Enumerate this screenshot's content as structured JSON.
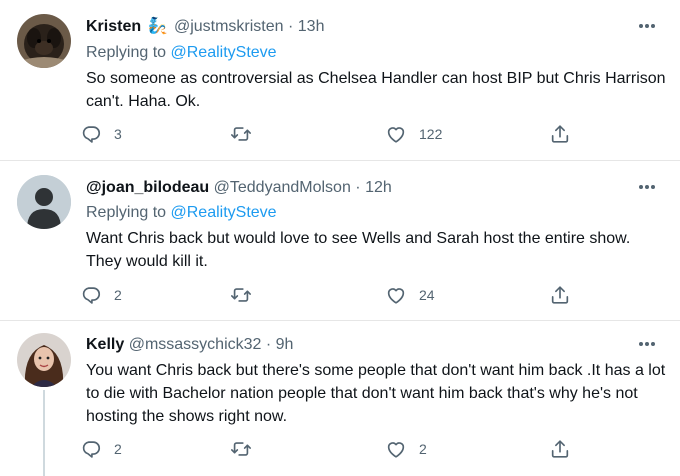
{
  "tweets": [
    {
      "name": "Kristen",
      "emoji": "🧞",
      "handle": "@justmskristen",
      "time": "· 13h",
      "replying_prefix": "Replying to ",
      "replying_to": "@RealitySteve",
      "text": "So someone as controversial as Chelsea Handler can host BIP but Chris Harrison can't. Haha. Ok.",
      "reply_count": "3",
      "retweet_count": "",
      "like_count": "122"
    },
    {
      "name": "@joan_bilodeau",
      "handle": "@TeddyandMolson",
      "time": "· 12h",
      "replying_prefix": "Replying to ",
      "replying_to": "@RealitySteve",
      "text": "Want Chris back but would love to see Wells and Sarah host the entire show. They would kill it.",
      "reply_count": "2",
      "retweet_count": "",
      "like_count": "24"
    },
    {
      "name": "Kelly",
      "handle": "@mssassychick32",
      "time": "· 9h",
      "text": "You want Chris back but  there's some people that don't want him back .It has a lot to die with Bachelor nation people that don't want him back that's why he's not hosting the shows right now.",
      "reply_count": "2",
      "retweet_count": "",
      "like_count": "2"
    }
  ],
  "icons": {
    "reply": "reply-icon",
    "retweet": "retweet-icon",
    "like": "heart-icon",
    "share": "share-icon",
    "more": "more-icon"
  },
  "colors": {
    "link": "#1d9bf0",
    "secondary_text": "#536471",
    "divider": "#e6e6e6"
  }
}
